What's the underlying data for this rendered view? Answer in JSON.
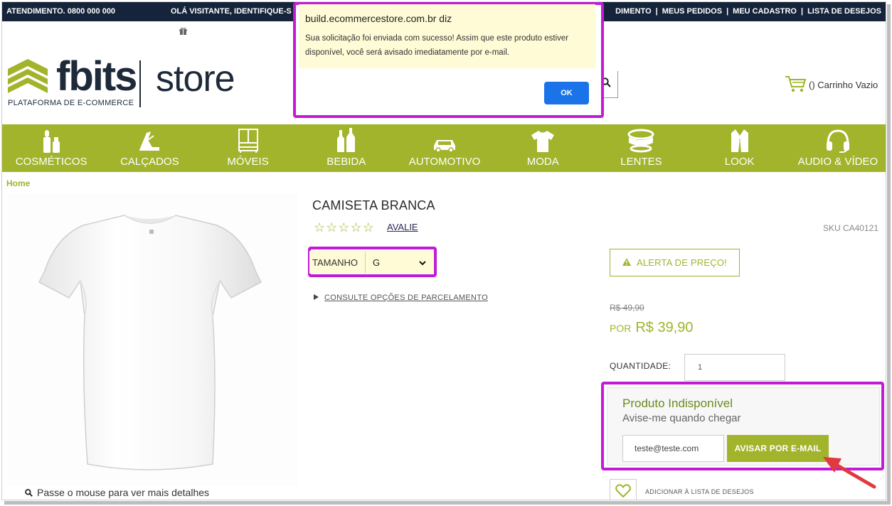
{
  "topbar": {
    "atendimento": "ATENDIMENTO. 0800 000 000",
    "greeting": "OLÁ VISITANTE, IDENTIFIQUE-S",
    "links": [
      "DIMENTO",
      "MEUS PEDIDOS",
      "MEU CADASTRO",
      "LISTA DE DESEJOS"
    ],
    "separator": "|"
  },
  "header": {
    "logo_main": "fbits",
    "logo_store": "store",
    "logo_tagline": "PLATAFORMA DE E-COMMERCE",
    "cart_text": "() Carrinho Vazio"
  },
  "nav": {
    "items": [
      {
        "label": "COSMÉTICOS",
        "icon": "cosmetics-icon"
      },
      {
        "label": "CALÇADOS",
        "icon": "shoes-icon"
      },
      {
        "label": "MÓVEIS",
        "icon": "furniture-icon"
      },
      {
        "label": "BEBIDA",
        "icon": "bottles-icon"
      },
      {
        "label": "AUTOMOTIVO",
        "icon": "car-icon"
      },
      {
        "label": "MODA",
        "icon": "tshirt-icon"
      },
      {
        "label": "LENTES",
        "icon": "lens-icon"
      },
      {
        "label": "LOOK",
        "icon": "jacket-icon"
      },
      {
        "label": "AUDIO & VÍDEO",
        "icon": "headphones-icon"
      }
    ]
  },
  "breadcrumb": {
    "home": "Home"
  },
  "product": {
    "title": "CAMISETA BRANCA",
    "review_link": "AVALIE",
    "rating_stars": 5,
    "size_label": "TAMANHO",
    "size_value": "G",
    "installments_link": "CONSULTE OPÇÕES DE PARCELAMENTO",
    "sku": "SKU CA40121",
    "price_alert": "ALERTA DE PREÇO!",
    "old_price": "R$ 49,90",
    "price_prefix": "POR",
    "price": "R$ 39,90",
    "quantity_label": "QUANTIDADE:",
    "quantity_value": "1",
    "zoom_hint": "Passe o mouse para ver mais detalhes",
    "wishlist_label": "ADICIONAR À LISTA DE DESEJOS"
  },
  "unavailable": {
    "title": "Produto Indisponível",
    "subtitle": "Avise-me quando chegar",
    "email_value": "teste@teste.com",
    "button": "AVISAR POR E-MAIL"
  },
  "dialog": {
    "title": "build.ecommercestore.com.br diz",
    "message": "Sua solicitação foi enviada com sucesso! Assim que este produto estiver disponível, você será avisado imediatamente por e-mail.",
    "ok": "OK"
  },
  "colors": {
    "accent": "#a2b42b",
    "topbar": "#15243a",
    "highlight": "#c21bd6",
    "dialog_bg": "#fffbd6",
    "ok_button": "#1a73e8"
  }
}
